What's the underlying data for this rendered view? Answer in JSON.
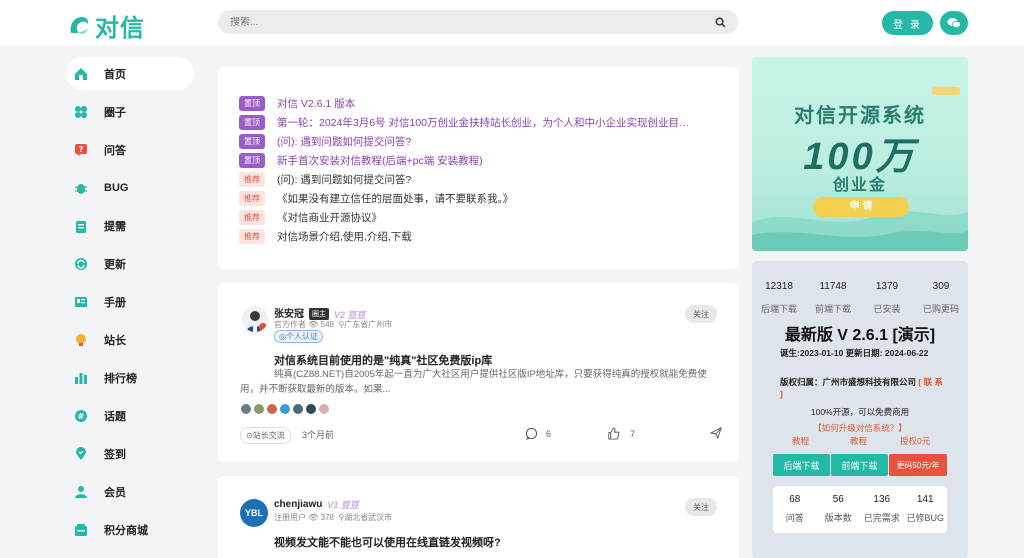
{
  "app": {
    "logo_text": "对信",
    "brand_color": "#26b8a6"
  },
  "search": {
    "placeholder": "搜索..."
  },
  "header": {
    "login_label": "登 录"
  },
  "sidebar": {
    "items": [
      {
        "label": "首页",
        "icon": "home-icon",
        "active": true
      },
      {
        "label": "圈子",
        "icon": "circles-icon"
      },
      {
        "label": "问答",
        "icon": "question-icon"
      },
      {
        "label": "BUG",
        "icon": "bug-icon"
      },
      {
        "label": "提需",
        "icon": "clipboard-icon"
      },
      {
        "label": "更新",
        "icon": "refresh-icon"
      },
      {
        "label": "手册",
        "icon": "manual-icon"
      },
      {
        "label": "站长",
        "icon": "trophy-icon"
      },
      {
        "label": "排行榜",
        "icon": "ranking-icon"
      },
      {
        "label": "话题",
        "icon": "topic-icon"
      },
      {
        "label": "签到",
        "icon": "location-icon"
      },
      {
        "label": "会员",
        "icon": "member-icon"
      },
      {
        "label": "积分商城",
        "icon": "shop-icon"
      }
    ]
  },
  "notices": [
    {
      "tag": "置顶",
      "kind": "top",
      "text": "对信 V2.6.1 版本"
    },
    {
      "tag": "置顶",
      "kind": "top",
      "text": "第一轮：2024年3月6号 对信100万创业金扶持站长创业，为个人和中小企业实现创业目…"
    },
    {
      "tag": "置顶",
      "kind": "top",
      "text": "(问): 遇到问题如何提交问答?"
    },
    {
      "tag": "置顶",
      "kind": "top",
      "text": "新手首次安装对信教程(后端+pc端 安装教程)"
    },
    {
      "tag": "推荐",
      "kind": "rec",
      "text": "(问): 遇到问题如何提交问答?"
    },
    {
      "tag": "推荐",
      "kind": "rec",
      "text": "《如果没有建立信任的层面处事，请不要联系我。》"
    },
    {
      "tag": "推荐",
      "kind": "rec",
      "text": "《对信商业开源协议》"
    },
    {
      "tag": "推荐",
      "kind": "rec",
      "text": "对信场景介绍,使用,介绍,下载"
    }
  ],
  "post1": {
    "author": "张安冠",
    "badge": "圈主",
    "level": "V2 豆豆",
    "role": "官方作者",
    "views": "548",
    "location": "广东省广州市",
    "cert": "个人认证",
    "follow": "关注",
    "title": "对信系统目前使用的是\"纯真\"社区免费版ip库",
    "body": "纯真(CZ88.NET)自2005年起一直为广大社区用户提供社区版IP地址库，只要获得纯真的授权就能免费使用，并不断获取最新的版本。如果...",
    "topic": "站长交流",
    "time": "3个月前",
    "comments": "6",
    "likes": "7"
  },
  "post2": {
    "author": "chenjiawu",
    "level": "V1 豆豆",
    "role": "注册用户",
    "views": "378",
    "location": "湖北省武汉市",
    "follow": "关注",
    "avatar_text": "YBL",
    "title": "视频发文能不能也可以使用在线直链发视频呀?"
  },
  "banner": {
    "title": "对信开源系统",
    "big": "100万",
    "sub": "创业金",
    "button": "申 请"
  },
  "info": {
    "stats": [
      {
        "value": "12318",
        "label": "后端下载"
      },
      {
        "value": "11748",
        "label": "前端下载"
      },
      {
        "value": "1379",
        "label": "已安装"
      },
      {
        "value": "309",
        "label": "已购更码"
      }
    ],
    "version": "最新版 V 2.6.1 [演示]",
    "dates": "诞生:2023-01-10 更新日期: 2024-06-22",
    "owner_prefix": "版权归属：广州市盛想科技有限公司",
    "owner_link": "[ 联 系 ]",
    "license": "100%开源，可以免费商用",
    "upgrade": "【如何升级对信系统？】",
    "tutorials": [
      "教程",
      "教程",
      "授权0元"
    ],
    "buttons": [
      {
        "label": "后端下载",
        "color": "#26b8a6"
      },
      {
        "label": "前端下载",
        "color": "#26b8a6"
      },
      {
        "label": "更码50元/年",
        "color": "#e8533f"
      }
    ],
    "stats2": [
      {
        "value": "68",
        "label": "问答"
      },
      {
        "value": "56",
        "label": "版本数"
      },
      {
        "value": "136",
        "label": "已完需求"
      },
      {
        "value": "141",
        "label": "已修BUG"
      }
    ]
  }
}
